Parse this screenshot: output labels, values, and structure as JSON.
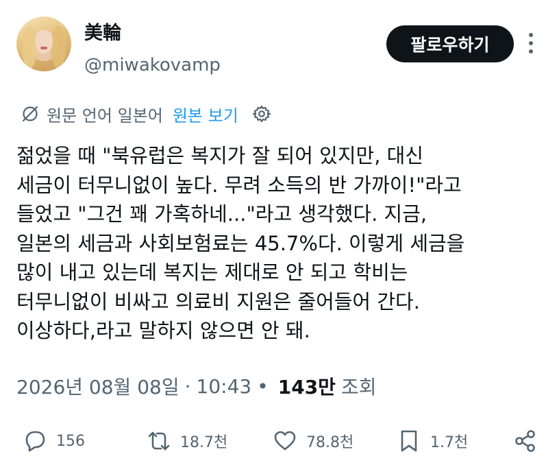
{
  "user": {
    "display_name": "美輪",
    "handle": "@miwakovamp"
  },
  "follow_button": {
    "label": "팔로우하기"
  },
  "translation": {
    "original_language": "원문 언어 일본어",
    "show_original": "원본 보기"
  },
  "tweet": {
    "text": "젊었을 때 \"북유럽은 복지가 잘 되어 있지만, 대신\n세금이 터무니없이 높다. 무려 소득의 반 가까이!\"라고\n들었고 \"그건 꽤 가혹하네...\"라고 생각했다. 지금,\n일본의 세금과 사회보험료는 45.7%다. 이렇게 세금을\n많이 내고 있는데 복지는 제대로 안 되고 학비는\n터무니없이 비싸고 의료비 지원은 줄어들어 간다.\n이상하다,라고 말하지 않으면 안 돼."
  },
  "meta": {
    "date": "2026년 08월 08일",
    "separator": "·",
    "time": "10:43",
    "bullet": "•",
    "views": "143만",
    "views_label": "조회"
  },
  "actions": {
    "replies": "156",
    "reposts": "18.7천",
    "likes": "78.8천",
    "bookmarks": "1.7천"
  },
  "icons": {
    "reply": "reply-icon",
    "repost": "repost-icon",
    "like": "heart-icon",
    "bookmark": "bookmark-icon",
    "share": "share-icon"
  },
  "colors": {
    "text": "#0f1419",
    "secondary": "#536471",
    "link": "#1d9bf0",
    "button": "#0f1419"
  }
}
